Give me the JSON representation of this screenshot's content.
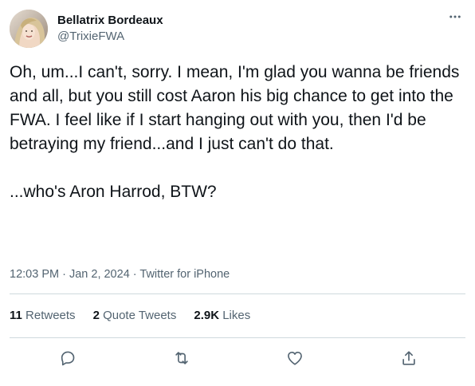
{
  "user": {
    "display_name": "Bellatrix Bordeaux",
    "handle": "@TrixieFWA",
    "avatar_icon": "profile-photo"
  },
  "tweet": {
    "text": "Oh, um...I can't, sorry. I mean, I'm glad you wanna be friends and all, but you still cost Aaron his big chance to get into the FWA. I feel like if I start hanging out with you, then I'd be betraying my friend...and I just can't do that.\n\n...who's Aron Harrod, BTW?",
    "time": "12:03 PM",
    "separator": " · ",
    "date": "Jan 2, 2024",
    "source": "Twitter for iPhone"
  },
  "stats": {
    "retweets_count": "11",
    "retweets_label": " Retweets",
    "quotes_count": "2",
    "quotes_label": " Quote Tweets",
    "likes_count": "2.9K",
    "likes_label": " Likes"
  },
  "icons": {
    "more": "more-horizontal-icon",
    "reply": "reply-icon",
    "retweet": "retweet-icon",
    "like": "like-heart-icon",
    "share": "share-icon"
  },
  "colors": {
    "text_primary": "#0f1419",
    "text_secondary": "#536471",
    "divider": "#cfd9de"
  }
}
